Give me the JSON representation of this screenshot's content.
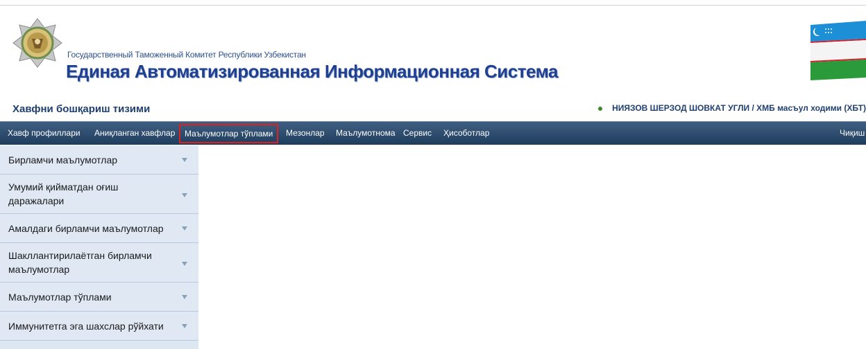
{
  "header": {
    "org_name": "Государственный Таможенный Комитет Республики Узбекистан",
    "system_name": "Единая Автоматизированная Информационная Система",
    "subsystem": "Хавфни бошқариш тизими",
    "user": "НИЯЗОВ ШЕРЗОД ШОВКАТ УГЛИ / ХМБ масъул ходими (ХБТ)"
  },
  "nav": {
    "items": [
      {
        "label": "Хавф профиллари"
      },
      {
        "label": "Аниқланган хавфлар"
      },
      {
        "label": "Маълумотлар тўплами",
        "active": true
      },
      {
        "label": "Мезонлар"
      },
      {
        "label": "Маълумотнома"
      },
      {
        "label": "Сервис"
      },
      {
        "label": "Ҳисоботлар"
      }
    ],
    "exit": "Чиқиш"
  },
  "sidebar": {
    "items": [
      {
        "label": "Бирламчи маълумотлар"
      },
      {
        "label": "Умумий қийматдан оғиш даражалари"
      },
      {
        "label": "Амалдаги бирламчи маълумотлар"
      },
      {
        "label": "Шакллантирилаётган бирламчи маълумотлар"
      },
      {
        "label": "Маълумотлар тўплами"
      },
      {
        "label": "Иммунитетга эга шахслар рўйхати"
      }
    ]
  },
  "colors": {
    "nav_bg": "#2b4a6c",
    "active_outline": "#e0201c",
    "sidebar_bg": "#dfe8f3"
  }
}
